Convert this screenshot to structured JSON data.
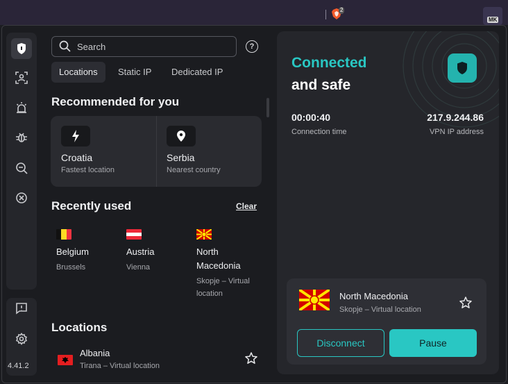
{
  "browser": {
    "brave_badge_count": "2",
    "extension_badge": "MK"
  },
  "version": "4.41.2",
  "search": {
    "placeholder": "Search"
  },
  "tabs": [
    {
      "label": "Locations",
      "active": true
    },
    {
      "label": "Static IP",
      "active": false
    },
    {
      "label": "Dedicated IP",
      "active": false
    }
  ],
  "recommended": {
    "title": "Recommended for you",
    "items": [
      {
        "name": "Croatia",
        "subtitle": "Fastest location",
        "icon": "bolt-icon"
      },
      {
        "name": "Serbia",
        "subtitle": "Nearest country",
        "icon": "location-pin-icon"
      }
    ]
  },
  "recently_used": {
    "title": "Recently used",
    "clear_label": "Clear",
    "items": [
      {
        "name": "Belgium",
        "city": "Brussels",
        "flag": "belgium-flag"
      },
      {
        "name": "Austria",
        "city": "Vienna",
        "flag": "austria-flag"
      },
      {
        "name": "North Macedonia",
        "city": "Skopje – Virtual location",
        "flag": "north-macedonia-flag"
      }
    ]
  },
  "locations": {
    "title": "Locations",
    "items": [
      {
        "name": "Albania",
        "city": "Tirana – Virtual location",
        "flag": "albania-flag"
      }
    ]
  },
  "status": {
    "line1": "Connected",
    "line2": "and safe",
    "connection_time": "00:00:40",
    "connection_time_label": "Connection time",
    "ip": "217.9.244.86",
    "ip_label": "VPN IP address"
  },
  "current": {
    "name": "North Macedonia",
    "subtitle": "Skopje – Virtual location",
    "disconnect_label": "Disconnect",
    "pause_label": "Pause"
  },
  "colors": {
    "accent": "#29c7c3",
    "background": "#1b1c20",
    "panel": "#25262b"
  }
}
